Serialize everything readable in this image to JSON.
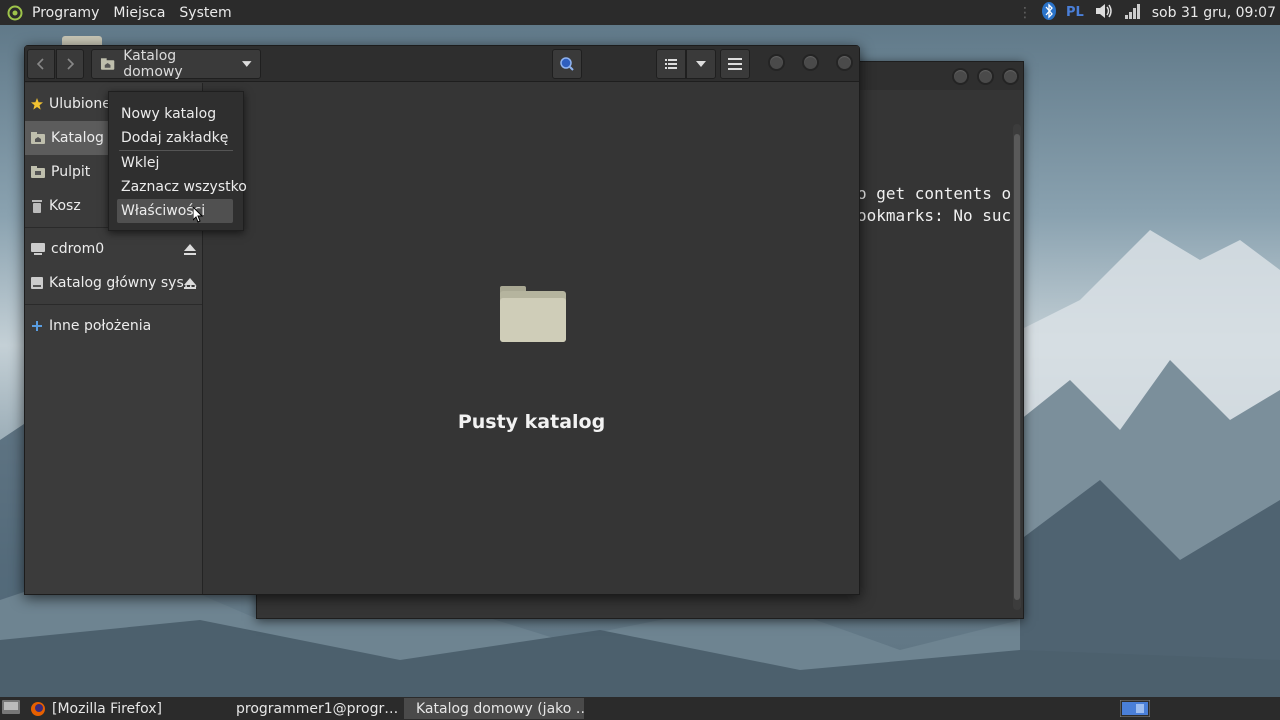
{
  "top_panel": {
    "menus": [
      "Programy",
      "Miejsca",
      "System"
    ],
    "lang": "PL",
    "clock": "sob 31 gru, 09:07"
  },
  "terminal": {
    "lines": [
      "o get contents o",
      "ookmarks: No suc"
    ]
  },
  "file_manager": {
    "path_label": "Katalog domowy",
    "sidebar": [
      {
        "label": "Ulubione",
        "icon": "star-icon"
      },
      {
        "label": "Katalog domowy",
        "icon": "home-folder-icon"
      },
      {
        "label": "Pulpit",
        "icon": "desktop-folder-icon"
      },
      {
        "label": "Kosz",
        "icon": "trash-icon"
      },
      {
        "label": "cdrom0",
        "icon": "drive-icon"
      },
      {
        "label": "Katalog główny sys…",
        "icon": "drive-icon"
      },
      {
        "label": "Inne położenia",
        "icon": "plus-icon"
      }
    ],
    "empty_text": "Pusty katalog"
  },
  "context_menu": {
    "items": [
      "Nowy katalog",
      "Dodaj zakładkę",
      "Wklej",
      "Zaznacz wszystko",
      "Właściwości"
    ]
  },
  "taskbar": {
    "tasks": [
      "[Mozilla Firefox]",
      "programmer1@progr…",
      "Katalog domowy (jako …"
    ]
  },
  "colors": {
    "panel_bg": "#2b2b2b",
    "window_bg": "#353535",
    "accent_blue": "#4a7fd8"
  }
}
